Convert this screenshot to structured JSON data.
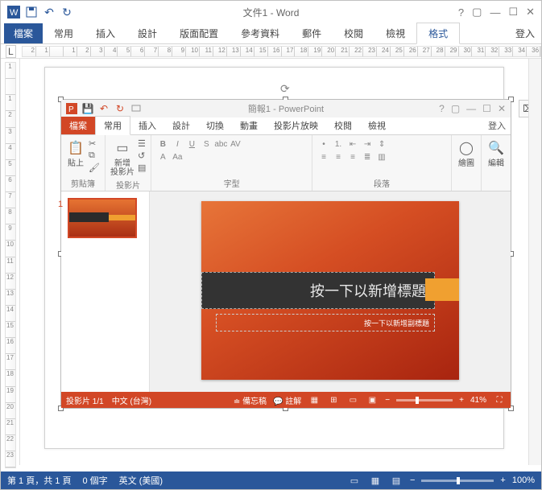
{
  "word": {
    "title": "文件1 - Word",
    "qat": {
      "word_icon": "word",
      "save": "save",
      "undo": "undo",
      "redo": "redo"
    },
    "tabs": {
      "file": "檔案",
      "home": "常用",
      "insert": "插入",
      "design": "設計",
      "layout": "版面配置",
      "references": "參考資料",
      "mailings": "郵件",
      "review": "校閱",
      "view": "檢視",
      "format": "格式"
    },
    "signin": "登入",
    "ruler_h": [
      "2",
      "1",
      "",
      "1",
      "2",
      "3",
      "4",
      "5",
      "6",
      "7",
      "8",
      "9",
      "10",
      "11",
      "12",
      "13",
      "14",
      "15",
      "16",
      "17",
      "18",
      "19",
      "20",
      "21",
      "22",
      "23",
      "24",
      "25",
      "26",
      "27",
      "28",
      "29",
      "30",
      "31",
      "32",
      "33",
      "34",
      "36"
    ],
    "ruler_v": [
      "1",
      "",
      "1",
      "2",
      "3",
      "4",
      "5",
      "6",
      "7",
      "8",
      "9",
      "10",
      "11",
      "12",
      "13",
      "14",
      "15",
      "16",
      "17",
      "18",
      "19",
      "20",
      "21",
      "22",
      "23"
    ],
    "status": {
      "page": "第 1 頁，共 1 頁",
      "words": "0 個字",
      "lang": "英文 (美國)",
      "zoom": "100%"
    }
  },
  "pp": {
    "title": "簡報1 - PowerPoint",
    "tabs": {
      "file": "檔案",
      "home": "常用",
      "insert": "插入",
      "design": "設計",
      "transitions": "切換",
      "animations": "動畫",
      "slideshow": "投影片放映",
      "review": "校閱",
      "view": "檢視"
    },
    "signin": "登入",
    "ribbon": {
      "clipboard": {
        "paste": "貼上",
        "label": "剪貼簿"
      },
      "slides": {
        "newslide": "新增\n投影片",
        "label": "投影片"
      },
      "font": {
        "label": "字型"
      },
      "paragraph": {
        "label": "段落"
      },
      "drawing": {
        "draw": "繪圖",
        "label": ""
      },
      "editing": {
        "edit": "編輯",
        "label": ""
      }
    },
    "thumb_num": "1",
    "slide": {
      "title_placeholder": "按一下以新增標題",
      "subtitle_placeholder": "按一下以新增副標題"
    },
    "status": {
      "slide": "投影片 1/1",
      "lang": "中文 (台灣)",
      "notes_flag": "備忘稿",
      "comments": "註解",
      "zoom": "41%"
    }
  }
}
